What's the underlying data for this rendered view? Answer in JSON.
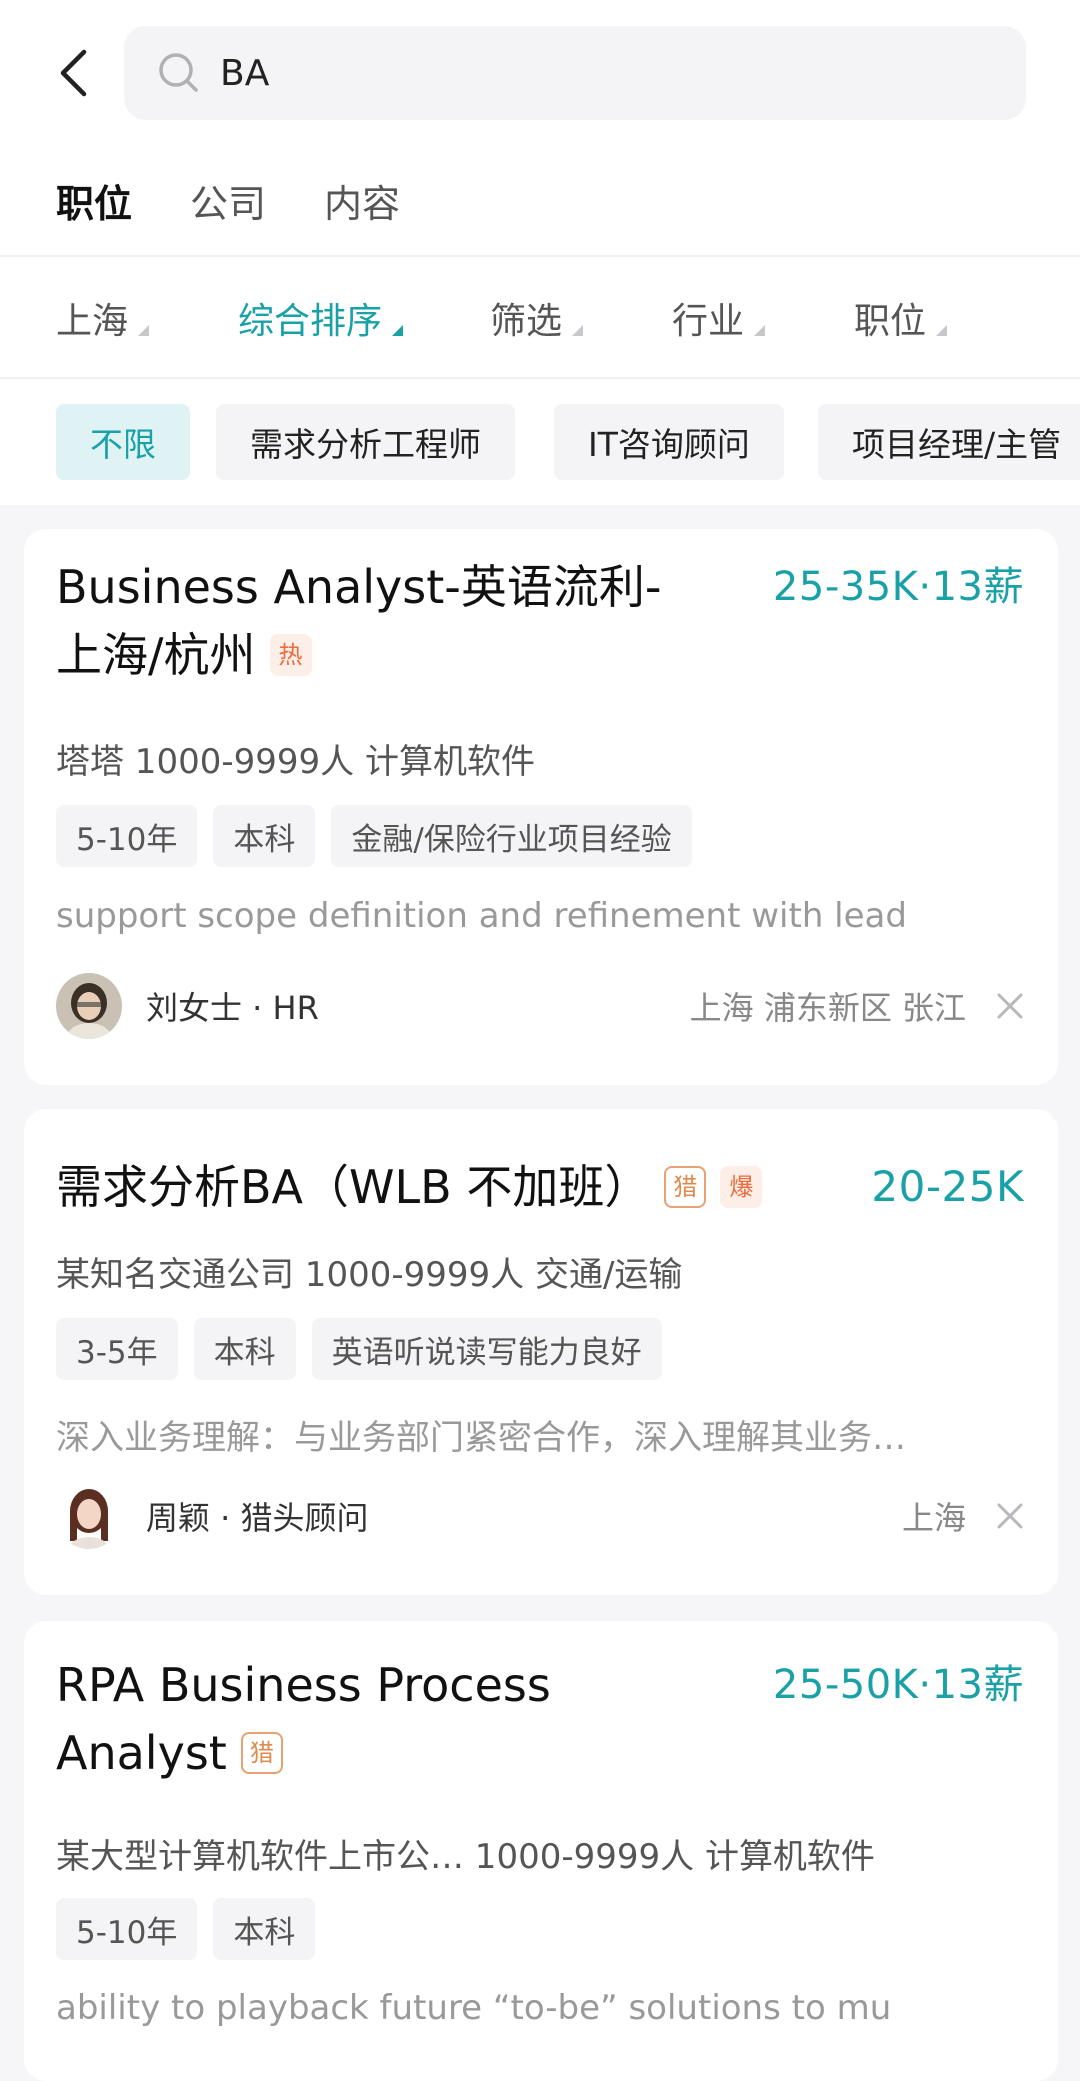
{
  "search": {
    "query": "BA"
  },
  "tabs": [
    "职位",
    "公司",
    "内容"
  ],
  "filters": [
    {
      "label": "上海",
      "active": false
    },
    {
      "label": "综合排序",
      "active": true
    },
    {
      "label": "筛选",
      "active": false
    },
    {
      "label": "行业",
      "active": false
    },
    {
      "label": "职位",
      "active": false
    }
  ],
  "chips": [
    {
      "label": "不限",
      "active": true
    },
    {
      "label": "需求分析工程师",
      "active": false
    },
    {
      "label": "IT咨询顾问",
      "active": false
    },
    {
      "label": "项目经理/主管",
      "active": false
    }
  ],
  "jobs": [
    {
      "title_line1": "Business Analyst-英语流利-",
      "title_line2": "上海/杭州",
      "badges": [
        "热"
      ],
      "salary": "25-35K·13薪",
      "company": "塔塔 1000-9999人 计算机软件",
      "tags": [
        "5-10年",
        "本科",
        "金融/保险行业项目经验"
      ],
      "desc": "support scope definition and refinement with lead",
      "recruiter": "刘女士 · HR",
      "location": "上海 浦东新区 张江"
    },
    {
      "title_line1": "需求分析BA（WLB 不加班）",
      "badges": [
        "猎",
        "爆"
      ],
      "salary": "20-25K",
      "company": "某知名交通公司 1000-9999人 交通/运输",
      "tags": [
        "3-5年",
        "本科",
        "英语听说读写能力良好"
      ],
      "desc": "深入业务理解：与业务部门紧密合作，深入理解其业务…",
      "recruiter": "周颖 · 猎头顾问",
      "location": "上海"
    },
    {
      "title_line1": "RPA Business Process",
      "title_line2": "Analyst",
      "badges": [
        "猎"
      ],
      "salary": "25-50K·13薪",
      "company": "某大型计算机软件上市公… 1000-9999人 计算机软件",
      "tags": [
        "5-10年",
        "本科"
      ],
      "desc": "ability to playback future “to-be” solutions to mu"
    }
  ],
  "colors": {
    "accent": "#1aa1a8",
    "hot": "#ef6b3c",
    "hunter": "#e08a4f"
  }
}
